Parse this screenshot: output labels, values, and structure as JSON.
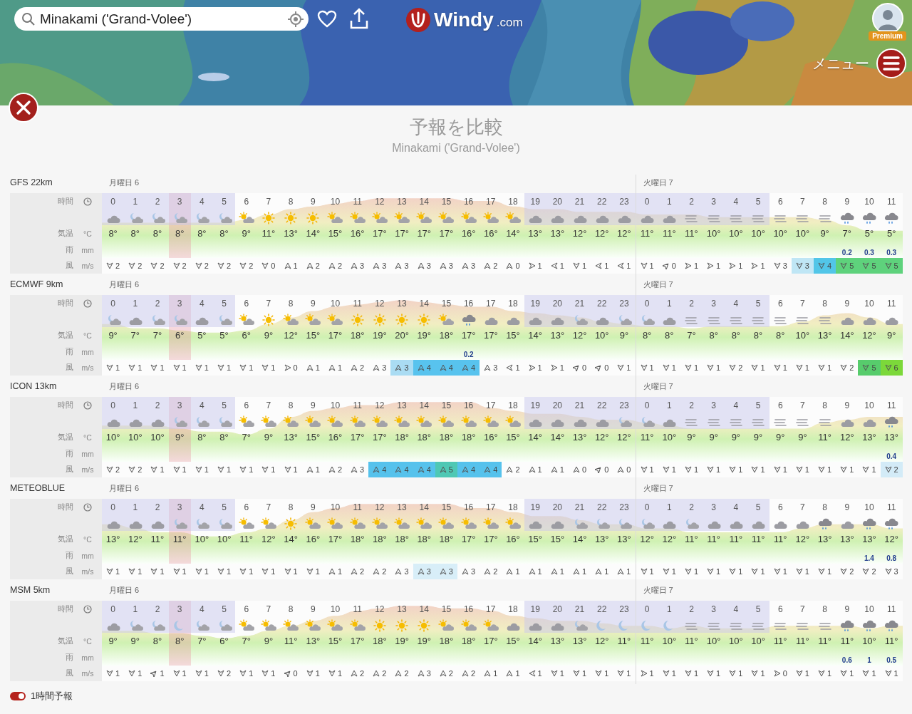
{
  "search": {
    "value": "Minakami ('Grand-Volee')"
  },
  "logo": {
    "name": "Windy",
    "suffix": ".com"
  },
  "account": {
    "badge": "Premium"
  },
  "menu": {
    "label": "メニュー"
  },
  "panel": {
    "title": "予報を比較",
    "subtitle": "Minakami ('Grand-Volee')"
  },
  "timeline": [
    {
      "night": true,
      "now": false
    },
    {
      "night": true,
      "now": false
    },
    {
      "night": true,
      "now": false
    },
    {
      "night": true,
      "now": true
    },
    {
      "night": true,
      "now": false
    },
    {
      "night": true,
      "now": false
    },
    {
      "night": false,
      "now": false
    },
    {
      "night": false,
      "now": false
    },
    {
      "night": false,
      "now": false
    },
    {
      "night": false,
      "now": false
    },
    {
      "night": false,
      "now": false
    },
    {
      "night": false,
      "now": false
    },
    {
      "night": false,
      "now": false
    },
    {
      "night": false,
      "now": false
    },
    {
      "night": false,
      "now": false
    },
    {
      "night": false,
      "now": false
    },
    {
      "night": false,
      "now": false
    },
    {
      "night": false,
      "now": false
    },
    {
      "night": false,
      "now": false
    },
    {
      "night": true,
      "now": false
    },
    {
      "night": true,
      "now": false
    },
    {
      "night": true,
      "now": false
    },
    {
      "night": true,
      "now": false
    },
    {
      "night": true,
      "now": false
    },
    {
      "night": true,
      "now": false
    },
    {
      "night": true,
      "now": false
    },
    {
      "night": true,
      "now": false
    },
    {
      "night": true,
      "now": false
    },
    {
      "night": true,
      "now": false
    },
    {
      "night": true,
      "now": false
    },
    {
      "night": false,
      "now": false
    },
    {
      "night": false,
      "now": false
    },
    {
      "night": false,
      "now": false
    },
    {
      "night": false,
      "now": false
    },
    {
      "night": false,
      "now": false
    },
    {
      "night": false,
      "now": false
    }
  ],
  "models": [
    {
      "name": "GFS 22km",
      "labels": {
        "time": "時間",
        "temp": "気温",
        "temp_unit": "°C",
        "rain": "雨",
        "rain_unit": "mm",
        "wind": "風",
        "wind_unit": "m/s"
      },
      "columns": [
        {
          "day": "月曜日 6",
          "hour": "0",
          "kind": "cloud",
          "temp": "8°",
          "wind": {
            "kind": "s",
            "speed": "2"
          }
        },
        {
          "hour": "1",
          "kind": "moon-cloud",
          "temp": "8°",
          "wind": {
            "kind": "s",
            "speed": "2"
          }
        },
        {
          "hour": "2",
          "kind": "moon-cloud",
          "temp": "8°",
          "wind": {
            "kind": "s",
            "speed": "2"
          }
        },
        {
          "hour": "3",
          "kind": "moon-cloud",
          "temp": "8°",
          "wind": {
            "kind": "s",
            "speed": "2"
          }
        },
        {
          "hour": "4",
          "kind": "moon-cloud",
          "temp": "8°",
          "wind": {
            "kind": "s",
            "speed": "2"
          }
        },
        {
          "hour": "5",
          "kind": "moon-cloud",
          "temp": "8°",
          "wind": {
            "kind": "s",
            "speed": "2"
          }
        },
        {
          "hour": "6",
          "kind": "sun-cloud",
          "temp": "9°",
          "wind": {
            "kind": "s",
            "speed": "2"
          }
        },
        {
          "hour": "7",
          "kind": "sun",
          "temp": "11°",
          "wind": {
            "kind": "s",
            "speed": "0"
          }
        },
        {
          "hour": "8",
          "kind": "sun",
          "temp": "13°",
          "wind": {
            "kind": "n",
            "speed": "1"
          }
        },
        {
          "hour": "9",
          "kind": "sun",
          "temp": "14°",
          "wind": {
            "kind": "n",
            "speed": "2"
          }
        },
        {
          "hour": "10",
          "kind": "sun-cloud",
          "temp": "15°",
          "wind": {
            "kind": "n",
            "speed": "2"
          }
        },
        {
          "hour": "11",
          "kind": "sun-cloud",
          "temp": "16°",
          "wind": {
            "kind": "n",
            "speed": "3"
          }
        },
        {
          "hour": "12",
          "kind": "sun-cloud",
          "temp": "17°",
          "wind": {
            "kind": "n",
            "speed": "3"
          }
        },
        {
          "hour": "13",
          "kind": "sun-cloud",
          "temp": "17°",
          "wind": {
            "kind": "n",
            "speed": "3"
          }
        },
        {
          "hour": "14",
          "kind": "sun-cloud",
          "temp": "17°",
          "wind": {
            "kind": "n",
            "speed": "3"
          }
        },
        {
          "hour": "15",
          "kind": "sun-cloud",
          "temp": "17°",
          "wind": {
            "kind": "n",
            "speed": "3"
          }
        },
        {
          "hour": "16",
          "kind": "sun-cloud",
          "temp": "16°",
          "wind": {
            "kind": "n",
            "speed": "3"
          }
        },
        {
          "hour": "17",
          "kind": "sun-cloud",
          "temp": "16°",
          "wind": {
            "kind": "n",
            "speed": "2"
          }
        },
        {
          "hour": "18",
          "kind": "sun-cloud",
          "temp": "14°",
          "wind": {
            "kind": "n",
            "speed": "0"
          }
        },
        {
          "hour": "19",
          "kind": "cloud",
          "temp": "13°",
          "wind": {
            "kind": "e",
            "speed": "1"
          }
        },
        {
          "hour": "20",
          "kind": "cloud",
          "temp": "13°",
          "wind": {
            "kind": "w",
            "speed": "1"
          }
        },
        {
          "hour": "21",
          "kind": "cloud",
          "temp": "12°",
          "wind": {
            "kind": "s",
            "speed": "1"
          }
        },
        {
          "hour": "22",
          "kind": "cloud",
          "temp": "12°",
          "wind": {
            "kind": "w",
            "speed": "1"
          }
        },
        {
          "hour": "23",
          "kind": "cloud",
          "temp": "12°",
          "wind": {
            "kind": "w",
            "speed": "1"
          }
        },
        {
          "day": "火曜日 7",
          "hour": "0",
          "kind": "cloud",
          "temp": "11°",
          "wind": {
            "kind": "s",
            "speed": "1"
          }
        },
        {
          "hour": "1",
          "kind": "cloud",
          "temp": "11°",
          "wind": {
            "kind": "ne",
            "speed": "0"
          }
        },
        {
          "hour": "2",
          "kind": "fog",
          "temp": "11°",
          "wind": {
            "kind": "e",
            "speed": "1"
          }
        },
        {
          "hour": "3",
          "kind": "fog",
          "temp": "10°",
          "wind": {
            "kind": "e",
            "speed": "1"
          }
        },
        {
          "hour": "4",
          "kind": "fog",
          "temp": "10°",
          "wind": {
            "kind": "e",
            "speed": "1"
          }
        },
        {
          "hour": "5",
          "kind": "fog",
          "temp": "10°",
          "wind": {
            "kind": "e",
            "speed": "1"
          }
        },
        {
          "hour": "6",
          "kind": "fog",
          "temp": "10°",
          "wind": {
            "kind": "s",
            "speed": "3"
          }
        },
        {
          "hour": "7",
          "kind": "fog",
          "temp": "10°",
          "wind": {
            "kind": "s",
            "speed": "3",
            "color": "#bfe6f5"
          }
        },
        {
          "hour": "8",
          "kind": "fog",
          "temp": "9°",
          "wind": {
            "kind": "s",
            "speed": "4",
            "color": "#52c6e8"
          }
        },
        {
          "hour": "9",
          "kind": "rain",
          "temp": "7°",
          "rain": "0.2",
          "wind": {
            "kind": "s",
            "speed": "5",
            "color": "#5ed27c"
          }
        },
        {
          "hour": "10",
          "kind": "rain",
          "temp": "5°",
          "rain": "0.3",
          "wind": {
            "kind": "s",
            "speed": "5",
            "color": "#5ed27c"
          }
        },
        {
          "hour": "11",
          "kind": "rain",
          "temp": "5°",
          "rain": "0.3",
          "wind": {
            "kind": "s",
            "speed": "5",
            "color": "#5ed27c"
          }
        }
      ]
    },
    {
      "name": "ECMWF 9km",
      "labels": {
        "time": "時間",
        "temp": "気温",
        "temp_unit": "°C",
        "rain": "雨",
        "rain_unit": "mm",
        "wind": "風",
        "wind_unit": "m/s"
      },
      "columns": [
        {
          "day": "月曜日 6",
          "hour": "0",
          "kind": "moon-cloud",
          "temp": "9°",
          "wind": {
            "kind": "s",
            "speed": "1"
          }
        },
        {
          "hour": "1",
          "kind": "cloud",
          "temp": "7°",
          "wind": {
            "kind": "s",
            "speed": "1"
          }
        },
        {
          "hour": "2",
          "kind": "moon-cloud",
          "temp": "7°",
          "wind": {
            "kind": "s",
            "speed": "1"
          }
        },
        {
          "hour": "3",
          "kind": "moon-cloud",
          "temp": "6°",
          "wind": {
            "kind": "s",
            "speed": "1"
          }
        },
        {
          "hour": "4",
          "kind": "cloud",
          "temp": "5°",
          "wind": {
            "kind": "s",
            "speed": "1"
          }
        },
        {
          "hour": "5",
          "kind": "moon-cloud",
          "temp": "5°",
          "wind": {
            "kind": "s",
            "speed": "1"
          }
        },
        {
          "hour": "6",
          "kind": "sun-cloud",
          "temp": "6°",
          "wind": {
            "kind": "s",
            "speed": "1"
          }
        },
        {
          "hour": "7",
          "kind": "sun",
          "temp": "9°",
          "wind": {
            "kind": "s",
            "speed": "1"
          }
        },
        {
          "hour": "8",
          "kind": "sun-cloud",
          "temp": "12°",
          "wind": {
            "kind": "e",
            "speed": "0"
          }
        },
        {
          "hour": "9",
          "kind": "sun-cloud",
          "temp": "15°",
          "wind": {
            "kind": "n",
            "speed": "1"
          }
        },
        {
          "hour": "10",
          "kind": "sun-cloud",
          "temp": "17°",
          "wind": {
            "kind": "n",
            "speed": "1"
          }
        },
        {
          "hour": "11",
          "kind": "sun",
          "temp": "18°",
          "wind": {
            "kind": "n",
            "speed": "2"
          }
        },
        {
          "hour": "12",
          "kind": "sun",
          "temp": "19°",
          "wind": {
            "kind": "n",
            "speed": "3"
          }
        },
        {
          "hour": "13",
          "kind": "sun",
          "temp": "20°",
          "wind": {
            "kind": "n",
            "speed": "3",
            "color": "#aadcf3"
          }
        },
        {
          "hour": "14",
          "kind": "sun",
          "temp": "19°",
          "wind": {
            "kind": "n",
            "speed": "4",
            "color": "#58c3ee"
          }
        },
        {
          "hour": "15",
          "kind": "sun-cloud",
          "temp": "18°",
          "wind": {
            "kind": "n",
            "speed": "4",
            "color": "#58c3ee"
          }
        },
        {
          "hour": "16",
          "kind": "rain",
          "temp": "17°",
          "rain": "0.2",
          "wind": {
            "kind": "n",
            "speed": "4",
            "color": "#58c3ee"
          }
        },
        {
          "hour": "17",
          "kind": "cloud",
          "temp": "17°",
          "wind": {
            "kind": "n",
            "speed": "3"
          }
        },
        {
          "hour": "18",
          "kind": "cloud",
          "temp": "15°",
          "wind": {
            "kind": "w",
            "speed": "1"
          }
        },
        {
          "hour": "19",
          "kind": "cloud",
          "temp": "14°",
          "wind": {
            "kind": "e",
            "speed": "1"
          }
        },
        {
          "hour": "20",
          "kind": "cloud",
          "temp": "13°",
          "wind": {
            "kind": "e",
            "speed": "1"
          }
        },
        {
          "hour": "21",
          "kind": "moon-cloud",
          "temp": "12°",
          "wind": {
            "kind": "ne",
            "speed": "0"
          }
        },
        {
          "hour": "22",
          "kind": "cloud",
          "temp": "10°",
          "wind": {
            "kind": "ne",
            "speed": "0"
          }
        },
        {
          "hour": "23",
          "kind": "moon-cloud",
          "temp": "9°",
          "wind": {
            "kind": "s",
            "speed": "1"
          }
        },
        {
          "day": "火曜日 7",
          "hour": "0",
          "kind": "moon-cloud",
          "temp": "8°",
          "wind": {
            "kind": "s",
            "speed": "1"
          }
        },
        {
          "hour": "1",
          "kind": "cloud",
          "temp": "8°",
          "wind": {
            "kind": "s",
            "speed": "1"
          }
        },
        {
          "hour": "2",
          "kind": "fog",
          "temp": "7°",
          "wind": {
            "kind": "s",
            "speed": "1"
          }
        },
        {
          "hour": "3",
          "kind": "fog",
          "temp": "8°",
          "wind": {
            "kind": "s",
            "speed": "1"
          }
        },
        {
          "hour": "4",
          "kind": "fog",
          "temp": "8°",
          "wind": {
            "kind": "s",
            "speed": "2"
          }
        },
        {
          "hour": "5",
          "kind": "fog",
          "temp": "8°",
          "wind": {
            "kind": "s",
            "speed": "1"
          }
        },
        {
          "hour": "6",
          "kind": "fog",
          "temp": "8°",
          "wind": {
            "kind": "s",
            "speed": "1"
          }
        },
        {
          "hour": "7",
          "kind": "fog",
          "temp": "10°",
          "wind": {
            "kind": "s",
            "speed": "1"
          }
        },
        {
          "hour": "8",
          "kind": "fog",
          "temp": "13°",
          "wind": {
            "kind": "s",
            "speed": "1"
          }
        },
        {
          "hour": "9",
          "kind": "cloud",
          "temp": "14°",
          "wind": {
            "kind": "s",
            "speed": "2"
          }
        },
        {
          "hour": "10",
          "kind": "cloud",
          "temp": "12°",
          "wind": {
            "kind": "s",
            "speed": "5",
            "color": "#57cc6c"
          }
        },
        {
          "hour": "11",
          "kind": "cloud",
          "temp": "9°",
          "wind": {
            "kind": "s",
            "speed": "6",
            "color": "#7cd83a"
          }
        }
      ]
    },
    {
      "name": "ICON 13km",
      "labels": {
        "time": "時間",
        "temp": "気温",
        "temp_unit": "°C",
        "rain": "雨",
        "rain_unit": "mm",
        "wind": "風",
        "wind_unit": "m/s"
      },
      "columns": [
        {
          "day": "月曜日 6",
          "hour": "0",
          "kind": "cloud",
          "temp": "10°",
          "wind": {
            "kind": "s",
            "speed": "2"
          }
        },
        {
          "hour": "1",
          "kind": "cloud",
          "temp": "10°",
          "wind": {
            "kind": "s",
            "speed": "2"
          }
        },
        {
          "hour": "2",
          "kind": "cloud",
          "temp": "10°",
          "wind": {
            "kind": "s",
            "speed": "1"
          }
        },
        {
          "hour": "3",
          "kind": "moon-cloud",
          "temp": "9°",
          "wind": {
            "kind": "s",
            "speed": "1"
          }
        },
        {
          "hour": "4",
          "kind": "moon-cloud",
          "temp": "8°",
          "wind": {
            "kind": "s",
            "speed": "1"
          }
        },
        {
          "hour": "5",
          "kind": "moon-cloud",
          "temp": "8°",
          "wind": {
            "kind": "s",
            "speed": "1"
          }
        },
        {
          "hour": "6",
          "kind": "sun-cloud",
          "temp": "7°",
          "wind": {
            "kind": "s",
            "speed": "1"
          }
        },
        {
          "hour": "7",
          "kind": "sun-cloud",
          "temp": "9°",
          "wind": {
            "kind": "s",
            "speed": "1"
          }
        },
        {
          "hour": "8",
          "kind": "sun-cloud",
          "temp": "13°",
          "wind": {
            "kind": "s",
            "speed": "1"
          }
        },
        {
          "hour": "9",
          "kind": "sun-cloud",
          "temp": "15°",
          "wind": {
            "kind": "n",
            "speed": "1"
          }
        },
        {
          "hour": "10",
          "kind": "sun-cloud",
          "temp": "16°",
          "wind": {
            "kind": "n",
            "speed": "2"
          }
        },
        {
          "hour": "11",
          "kind": "sun-cloud",
          "temp": "17°",
          "wind": {
            "kind": "n",
            "speed": "3"
          }
        },
        {
          "hour": "12",
          "kind": "sun-cloud",
          "temp": "17°",
          "wind": {
            "kind": "n",
            "speed": "4",
            "color": "#56c2ec"
          }
        },
        {
          "hour": "13",
          "kind": "sun-cloud",
          "temp": "18°",
          "wind": {
            "kind": "n",
            "speed": "4",
            "color": "#56c2ec"
          }
        },
        {
          "hour": "14",
          "kind": "sun-cloud",
          "temp": "18°",
          "wind": {
            "kind": "n",
            "speed": "4",
            "color": "#56c2ec"
          }
        },
        {
          "hour": "15",
          "kind": "sun-cloud",
          "temp": "18°",
          "wind": {
            "kind": "n",
            "speed": "5",
            "color": "#4fc8b4"
          }
        },
        {
          "hour": "16",
          "kind": "sun-cloud",
          "temp": "18°",
          "wind": {
            "kind": "n",
            "speed": "4",
            "color": "#56c2ec"
          }
        },
        {
          "hour": "17",
          "kind": "sun-cloud",
          "temp": "16°",
          "wind": {
            "kind": "n",
            "speed": "4",
            "color": "#56c2ec"
          }
        },
        {
          "hour": "18",
          "kind": "sun-cloud",
          "temp": "15°",
          "wind": {
            "kind": "n",
            "speed": "2"
          }
        },
        {
          "hour": "19",
          "kind": "cloud",
          "temp": "14°",
          "wind": {
            "kind": "n",
            "speed": "1"
          }
        },
        {
          "hour": "20",
          "kind": "cloud",
          "temp": "14°",
          "wind": {
            "kind": "n",
            "speed": "1"
          }
        },
        {
          "hour": "21",
          "kind": "cloud",
          "temp": "13°",
          "wind": {
            "kind": "n",
            "speed": "0"
          }
        },
        {
          "hour": "22",
          "kind": "cloud",
          "temp": "12°",
          "wind": {
            "kind": "ne",
            "speed": "0"
          }
        },
        {
          "hour": "23",
          "kind": "moon-cloud",
          "temp": "12°",
          "wind": {
            "kind": "n",
            "speed": "0"
          }
        },
        {
          "day": "火曜日 7",
          "hour": "0",
          "kind": "moon-cloud",
          "temp": "11°",
          "wind": {
            "kind": "s",
            "speed": "1"
          }
        },
        {
          "hour": "1",
          "kind": "cloud",
          "temp": "10°",
          "wind": {
            "kind": "s",
            "speed": "1"
          }
        },
        {
          "hour": "2",
          "kind": "fog",
          "temp": "9°",
          "wind": {
            "kind": "s",
            "speed": "1"
          }
        },
        {
          "hour": "3",
          "kind": "fog",
          "temp": "9°",
          "wind": {
            "kind": "s",
            "speed": "1"
          }
        },
        {
          "hour": "4",
          "kind": "fog",
          "temp": "9°",
          "wind": {
            "kind": "s",
            "speed": "1"
          }
        },
        {
          "hour": "5",
          "kind": "fog",
          "temp": "9°",
          "wind": {
            "kind": "s",
            "speed": "1"
          }
        },
        {
          "hour": "6",
          "kind": "fog",
          "temp": "9°",
          "wind": {
            "kind": "s",
            "speed": "1"
          }
        },
        {
          "hour": "7",
          "kind": "fog",
          "temp": "9°",
          "wind": {
            "kind": "s",
            "speed": "1"
          }
        },
        {
          "hour": "8",
          "kind": "fog",
          "temp": "11°",
          "wind": {
            "kind": "s",
            "speed": "1"
          }
        },
        {
          "hour": "9",
          "kind": "cloud",
          "temp": "12°",
          "wind": {
            "kind": "s",
            "speed": "1"
          }
        },
        {
          "hour": "10",
          "kind": "cloud",
          "temp": "13°",
          "wind": {
            "kind": "s",
            "speed": "1"
          }
        },
        {
          "hour": "11",
          "kind": "rain",
          "temp": "13°",
          "rain": "0.4",
          "wind": {
            "kind": "s",
            "speed": "2",
            "color": "#d3ebf7"
          }
        }
      ]
    },
    {
      "name": "METEOBLUE",
      "labels": {
        "time": "時間",
        "temp": "気温",
        "temp_unit": "°C",
        "rain": "雨",
        "rain_unit": "mm",
        "wind": "風",
        "wind_unit": "m/s"
      },
      "columns": [
        {
          "day": "月曜日 6",
          "hour": "0",
          "kind": "cloud",
          "temp": "13°",
          "wind": {
            "kind": "s",
            "speed": "1"
          }
        },
        {
          "hour": "1",
          "kind": "cloud",
          "temp": "12°",
          "wind": {
            "kind": "s",
            "speed": "1"
          }
        },
        {
          "hour": "2",
          "kind": "cloud",
          "temp": "11°",
          "wind": {
            "kind": "s",
            "speed": "1"
          }
        },
        {
          "hour": "3",
          "kind": "moon-cloud",
          "temp": "11°",
          "wind": {
            "kind": "s",
            "speed": "1"
          }
        },
        {
          "hour": "4",
          "kind": "moon-cloud",
          "temp": "10°",
          "wind": {
            "kind": "s",
            "speed": "1"
          }
        },
        {
          "hour": "5",
          "kind": "moon-cloud",
          "temp": "10°",
          "wind": {
            "kind": "s",
            "speed": "1"
          }
        },
        {
          "hour": "6",
          "kind": "sun-cloud",
          "temp": "11°",
          "wind": {
            "kind": "s",
            "speed": "1"
          }
        },
        {
          "hour": "7",
          "kind": "sun-cloud",
          "temp": "12°",
          "wind": {
            "kind": "s",
            "speed": "1"
          }
        },
        {
          "hour": "8",
          "kind": "sun",
          "temp": "14°",
          "wind": {
            "kind": "s",
            "speed": "1"
          }
        },
        {
          "hour": "9",
          "kind": "sun-cloud",
          "temp": "16°",
          "wind": {
            "kind": "s",
            "speed": "1"
          }
        },
        {
          "hour": "10",
          "kind": "sun-cloud",
          "temp": "17°",
          "wind": {
            "kind": "n",
            "speed": "1"
          }
        },
        {
          "hour": "11",
          "kind": "sun-cloud",
          "temp": "18°",
          "wind": {
            "kind": "n",
            "speed": "2"
          }
        },
        {
          "hour": "12",
          "kind": "sun-cloud",
          "temp": "18°",
          "wind": {
            "kind": "n",
            "speed": "2"
          }
        },
        {
          "hour": "13",
          "kind": "sun-cloud",
          "temp": "18°",
          "wind": {
            "kind": "n",
            "speed": "3"
          }
        },
        {
          "hour": "14",
          "kind": "sun-cloud",
          "temp": "18°",
          "wind": {
            "kind": "n",
            "speed": "3",
            "color": "#d8eef8"
          }
        },
        {
          "hour": "15",
          "kind": "sun-cloud",
          "temp": "18°",
          "wind": {
            "kind": "n",
            "speed": "3",
            "color": "#d8eef8"
          }
        },
        {
          "hour": "16",
          "kind": "sun-cloud",
          "temp": "17°",
          "wind": {
            "kind": "n",
            "speed": "3"
          }
        },
        {
          "hour": "17",
          "kind": "sun-cloud",
          "temp": "17°",
          "wind": {
            "kind": "n",
            "speed": "2"
          }
        },
        {
          "hour": "18",
          "kind": "sun-cloud",
          "temp": "16°",
          "wind": {
            "kind": "n",
            "speed": "1"
          }
        },
        {
          "hour": "19",
          "kind": "cloud",
          "temp": "15°",
          "wind": {
            "kind": "n",
            "speed": "1"
          }
        },
        {
          "hour": "20",
          "kind": "cloud",
          "temp": "15°",
          "wind": {
            "kind": "n",
            "speed": "1"
          }
        },
        {
          "hour": "21",
          "kind": "moon-cloud",
          "temp": "14°",
          "wind": {
            "kind": "n",
            "speed": "1"
          }
        },
        {
          "hour": "22",
          "kind": "moon-cloud",
          "temp": "13°",
          "wind": {
            "kind": "n",
            "speed": "1"
          }
        },
        {
          "hour": "23",
          "kind": "moon-cloud",
          "temp": "13°",
          "wind": {
            "kind": "n",
            "speed": "1"
          }
        },
        {
          "day": "火曜日 7",
          "hour": "0",
          "kind": "moon-cloud",
          "temp": "12°",
          "wind": {
            "kind": "s",
            "speed": "1"
          }
        },
        {
          "hour": "1",
          "kind": "cloud",
          "temp": "12°",
          "wind": {
            "kind": "s",
            "speed": "1"
          }
        },
        {
          "hour": "2",
          "kind": "moon-cloud",
          "temp": "11°",
          "wind": {
            "kind": "s",
            "speed": "1"
          }
        },
        {
          "hour": "3",
          "kind": "cloud",
          "temp": "11°",
          "wind": {
            "kind": "s",
            "speed": "1"
          }
        },
        {
          "hour": "4",
          "kind": "cloud",
          "temp": "11°",
          "wind": {
            "kind": "s",
            "speed": "1"
          }
        },
        {
          "hour": "5",
          "kind": "cloud",
          "temp": "11°",
          "wind": {
            "kind": "s",
            "speed": "1"
          }
        },
        {
          "hour": "6",
          "kind": "cloud",
          "temp": "11°",
          "wind": {
            "kind": "s",
            "speed": "1"
          }
        },
        {
          "hour": "7",
          "kind": "cloud",
          "temp": "12°",
          "wind": {
            "kind": "s",
            "speed": "1"
          }
        },
        {
          "hour": "8",
          "kind": "rain",
          "temp": "13°",
          "wind": {
            "kind": "s",
            "speed": "1"
          }
        },
        {
          "hour": "9",
          "kind": "cloud",
          "temp": "13°",
          "wind": {
            "kind": "s",
            "speed": "2"
          }
        },
        {
          "hour": "10",
          "kind": "rain",
          "temp": "13°",
          "rain": "1.4",
          "wind": {
            "kind": "s",
            "speed": "2"
          }
        },
        {
          "hour": "11",
          "kind": "rain",
          "temp": "12°",
          "rain": "0.8",
          "wind": {
            "kind": "s",
            "speed": "3"
          }
        }
      ]
    },
    {
      "name": "MSM 5km",
      "labels": {
        "time": "時間",
        "temp": "気温",
        "temp_unit": "°C",
        "rain": "雨",
        "rain_unit": "mm",
        "wind": "風",
        "wind_unit": "m/s"
      },
      "columns": [
        {
          "day": "月曜日 6",
          "hour": "0",
          "kind": "cloud",
          "temp": "9°",
          "wind": {
            "kind": "s",
            "speed": "1"
          }
        },
        {
          "hour": "1",
          "kind": "moon-cloud",
          "temp": "9°",
          "wind": {
            "kind": "s",
            "speed": "1"
          }
        },
        {
          "hour": "2",
          "kind": "moon-cloud",
          "temp": "8°",
          "wind": {
            "kind": "ne",
            "speed": "1"
          }
        },
        {
          "hour": "3",
          "kind": "moon",
          "temp": "8°",
          "wind": {
            "kind": "s",
            "speed": "1"
          }
        },
        {
          "hour": "4",
          "kind": "moon-cloud",
          "temp": "7°",
          "wind": {
            "kind": "s",
            "speed": "1"
          }
        },
        {
          "hour": "5",
          "kind": "moon-cloud",
          "temp": "6°",
          "wind": {
            "kind": "s",
            "speed": "2"
          }
        },
        {
          "hour": "6",
          "kind": "sun-cloud",
          "temp": "7°",
          "wind": {
            "kind": "s",
            "speed": "1"
          }
        },
        {
          "hour": "7",
          "kind": "sun-cloud",
          "temp": "9°",
          "wind": {
            "kind": "s",
            "speed": "1"
          }
        },
        {
          "hour": "8",
          "kind": "sun-cloud",
          "temp": "11°",
          "wind": {
            "kind": "ne",
            "speed": "0"
          }
        },
        {
          "hour": "9",
          "kind": "sun-cloud",
          "temp": "13°",
          "wind": {
            "kind": "s",
            "speed": "1"
          }
        },
        {
          "hour": "10",
          "kind": "sun-cloud",
          "temp": "15°",
          "wind": {
            "kind": "s",
            "speed": "1"
          }
        },
        {
          "hour": "11",
          "kind": "sun-cloud",
          "temp": "17°",
          "wind": {
            "kind": "n",
            "speed": "2"
          }
        },
        {
          "hour": "12",
          "kind": "sun",
          "temp": "18°",
          "wind": {
            "kind": "n",
            "speed": "2"
          }
        },
        {
          "hour": "13",
          "kind": "sun",
          "temp": "19°",
          "wind": {
            "kind": "n",
            "speed": "2"
          }
        },
        {
          "hour": "14",
          "kind": "sun",
          "temp": "19°",
          "wind": {
            "kind": "n",
            "speed": "3"
          }
        },
        {
          "hour": "15",
          "kind": "sun-cloud",
          "temp": "18°",
          "wind": {
            "kind": "n",
            "speed": "2"
          }
        },
        {
          "hour": "16",
          "kind": "sun-cloud",
          "temp": "18°",
          "wind": {
            "kind": "n",
            "speed": "2"
          }
        },
        {
          "hour": "17",
          "kind": "sun-cloud",
          "temp": "17°",
          "wind": {
            "kind": "n",
            "speed": "1"
          }
        },
        {
          "hour": "18",
          "kind": "cloud",
          "temp": "15°",
          "wind": {
            "kind": "n",
            "speed": "1"
          }
        },
        {
          "hour": "19",
          "kind": "cloud",
          "temp": "14°",
          "wind": {
            "kind": "w",
            "speed": "1"
          }
        },
        {
          "hour": "20",
          "kind": "cloud",
          "temp": "13°",
          "wind": {
            "kind": "s",
            "speed": "1"
          }
        },
        {
          "hour": "21",
          "kind": "moon-cloud",
          "temp": "13°",
          "wind": {
            "kind": "s",
            "speed": "1"
          }
        },
        {
          "hour": "22",
          "kind": "moon",
          "temp": "12°",
          "wind": {
            "kind": "s",
            "speed": "1"
          }
        },
        {
          "hour": "23",
          "kind": "moon",
          "temp": "11°",
          "wind": {
            "kind": "s",
            "speed": "1"
          }
        },
        {
          "day": "火曜日 7",
          "hour": "0",
          "kind": "moon",
          "temp": "11°",
          "wind": {
            "kind": "e",
            "speed": "1"
          }
        },
        {
          "hour": "1",
          "kind": "moon",
          "temp": "10°",
          "wind": {
            "kind": "s",
            "speed": "1"
          }
        },
        {
          "hour": "2",
          "kind": "fog",
          "temp": "11°",
          "wind": {
            "kind": "s",
            "speed": "1"
          }
        },
        {
          "hour": "3",
          "kind": "fog",
          "temp": "10°",
          "wind": {
            "kind": "s",
            "speed": "1"
          }
        },
        {
          "hour": "4",
          "kind": "fog",
          "temp": "10°",
          "wind": {
            "kind": "s",
            "speed": "1"
          }
        },
        {
          "hour": "5",
          "kind": "fog",
          "temp": "10°",
          "wind": {
            "kind": "s",
            "speed": "1"
          }
        },
        {
          "hour": "6",
          "kind": "fog",
          "temp": "11°",
          "wind": {
            "kind": "e",
            "speed": "0"
          }
        },
        {
          "hour": "7",
          "kind": "fog",
          "temp": "11°",
          "wind": {
            "kind": "s",
            "speed": "1"
          }
        },
        {
          "hour": "8",
          "kind": "fog",
          "temp": "11°",
          "wind": {
            "kind": "s",
            "speed": "1"
          }
        },
        {
          "hour": "9",
          "kind": "rain",
          "temp": "11°",
          "rain": "0.6",
          "wind": {
            "kind": "s",
            "speed": "1"
          }
        },
        {
          "hour": "10",
          "kind": "rain",
          "temp": "10°",
          "rain": "1",
          "wind": {
            "kind": "s",
            "speed": "1"
          }
        },
        {
          "hour": "11",
          "kind": "rain",
          "temp": "11°",
          "rain": "0.5",
          "wind": {
            "kind": "s",
            "speed": "1"
          }
        }
      ]
    }
  ],
  "toggle": {
    "label": "1時間予報",
    "on": true
  }
}
